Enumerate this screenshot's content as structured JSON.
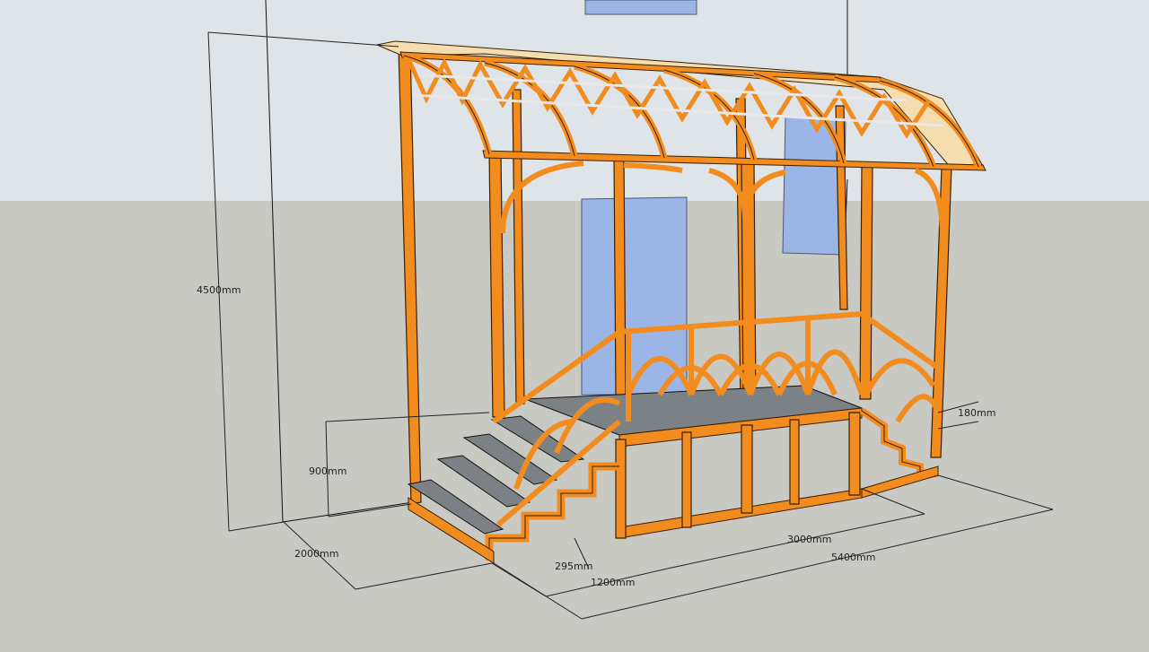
{
  "colors": {
    "sky": "#dfe4e8",
    "ground": "#c9c9c4",
    "frame": "#f28c1e",
    "frame_outline": "#3a2000",
    "glass": "#9bb6e6",
    "step_tread": "#7b8184",
    "dim_line": "#222222"
  },
  "dimensions": {
    "height_total": "4500mm",
    "platform_height": "900mm",
    "depth": "2000mm",
    "step_rise": "180mm",
    "step_run": "295mm",
    "stair_width": "1200mm",
    "platform_length": "3000mm",
    "total_length": "5400mm"
  }
}
